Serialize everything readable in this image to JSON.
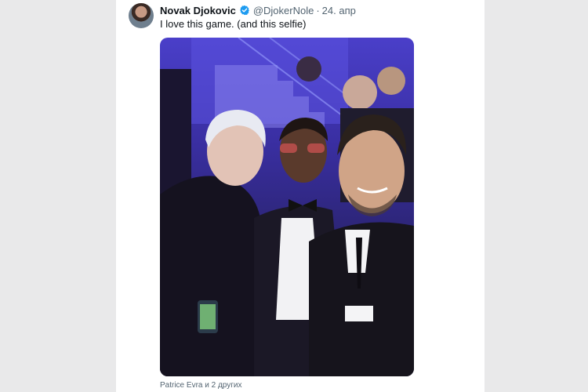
{
  "tweet": {
    "author_name": "Novak Djokovic",
    "handle": "@DjokerNole",
    "separator": "·",
    "date": "24. апр",
    "text": "I love this game. (and this selfie)",
    "tagged": "Patrice Evra и 2 других"
  },
  "colors": {
    "verified": "#1d9bf0",
    "text_primary": "#0f1419",
    "text_secondary": "#536471"
  },
  "icons": {
    "verified": "verified-badge-icon"
  }
}
